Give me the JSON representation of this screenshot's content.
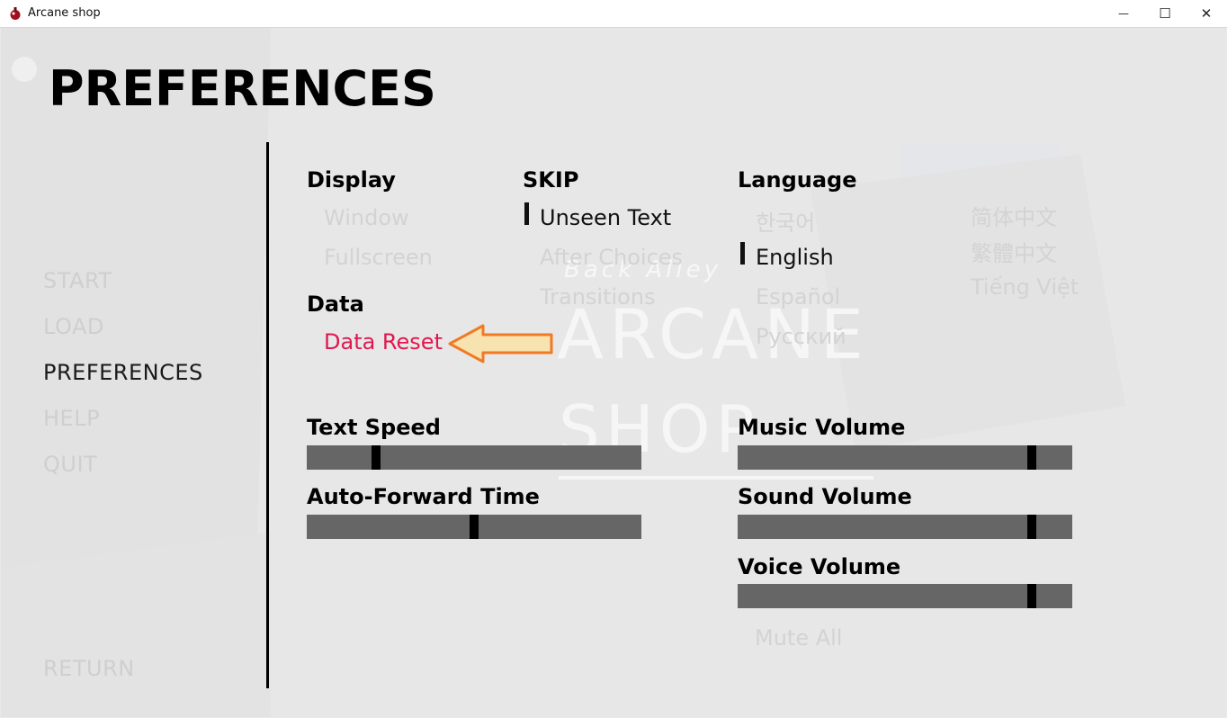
{
  "window": {
    "title": "Arcane shop",
    "minimize_glyph": "—",
    "maximize_glyph": "☐",
    "close_glyph": "✕"
  },
  "screen_title": "PREFERENCES",
  "nav": {
    "start": "START",
    "load": "LOAD",
    "preferences": "PREFERENCES",
    "help": "HELP",
    "quit": "QUIT",
    "return": "RETURN"
  },
  "display": {
    "heading": "Display",
    "window": "Window",
    "fullscreen": "Fullscreen"
  },
  "data": {
    "heading": "Data",
    "reset": "Data Reset"
  },
  "skip": {
    "heading": "SKIP",
    "unseen": "Unseen Text",
    "after_choices": "After Choices",
    "transitions": "Transitions"
  },
  "language": {
    "heading": "Language",
    "korean": "한국어",
    "english": "English",
    "spanish": "Español",
    "russian": "Русский",
    "chinese_simplified": "简体中文",
    "chinese_traditional": "繁體中文",
    "vietnamese": "Tiếng Việt"
  },
  "background_logo": {
    "line1": "Back Alley",
    "line2": "ARCANE",
    "line3": "SHOP"
  },
  "sliders": {
    "text_speed": {
      "label": "Text Speed",
      "value": 0.2
    },
    "auto_forward": {
      "label": "Auto-Forward Time",
      "value": 0.5
    },
    "music_volume": {
      "label": "Music Volume",
      "value": 0.89
    },
    "sound_volume": {
      "label": "Sound Volume",
      "value": 0.89
    },
    "voice_volume": {
      "label": "Voice Volume",
      "value": 0.89
    }
  },
  "mute_all": "Mute All",
  "colors": {
    "accent_red": "#e0184f",
    "arrow_fill": "#f7e3b0",
    "arrow_stroke": "#f07a24",
    "bar": "#666666",
    "thumb": "#000000"
  }
}
